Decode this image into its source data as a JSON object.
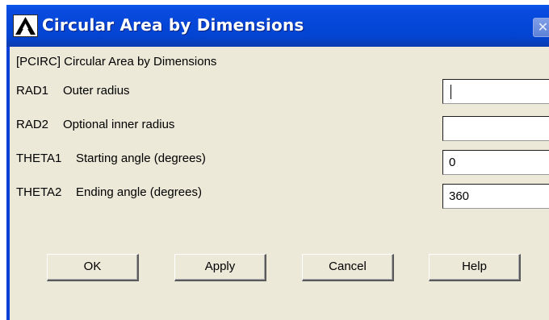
{
  "window": {
    "title": "Circular Area by Dimensions",
    "close_glyph": "✕"
  },
  "header": {
    "command_label": "[PCIRC]  Circular Area by Dimensions"
  },
  "fields": [
    {
      "tag": "RAD1",
      "label": "Outer radius",
      "value": ""
    },
    {
      "tag": "RAD2",
      "label": "Optional inner radius",
      "value": ""
    },
    {
      "tag": "THETA1",
      "label": "Starting angle (degrees)",
      "value": "0"
    },
    {
      "tag": "THETA2",
      "label": "Ending angle (degrees)",
      "value": "360"
    }
  ],
  "buttons": {
    "ok": "OK",
    "apply": "Apply",
    "cancel": "Cancel",
    "help": "Help"
  },
  "colors": {
    "titlebar": "#0546d8",
    "dialog_bg": "#ece9d8"
  }
}
